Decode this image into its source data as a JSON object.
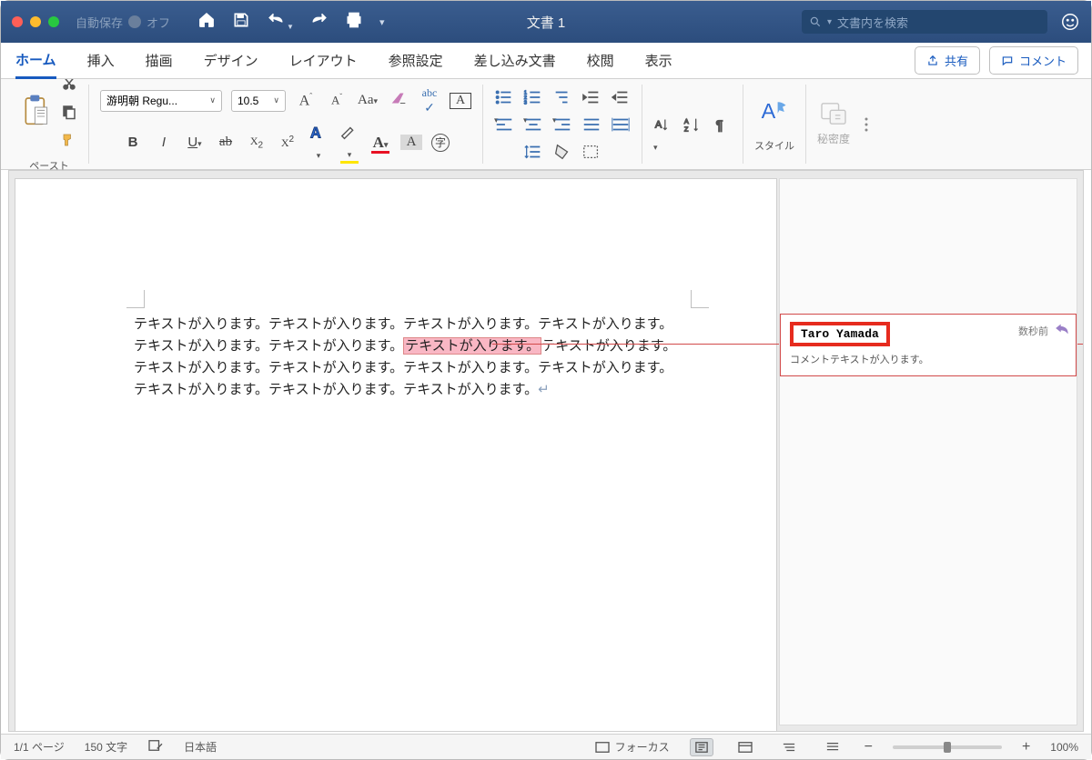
{
  "titlebar": {
    "autosave_label": "自動保存",
    "autosave_state": "オフ",
    "doc_title": "文書 1",
    "search_placeholder": "文書内を検索"
  },
  "tabs": {
    "items": [
      "ホーム",
      "挿入",
      "描画",
      "デザイン",
      "レイアウト",
      "参照設定",
      "差し込み文書",
      "校閲",
      "表示"
    ],
    "active": 0,
    "share": "共有",
    "comment": "コメント"
  },
  "ribbon": {
    "paste": "ペースト",
    "font_name": "游明朝 Regu...",
    "font_size": "10.5",
    "styles": "スタイル",
    "sensitivity": "秘密度"
  },
  "document": {
    "body_before": "テキストが入ります。テキストが入ります。テキストが入ります。テキストが入ります。テキストが入ります。テキストが入ります。",
    "body_highlight": "テキストが入ります。",
    "body_after": "テキストが入ります。テキストが入ります。テキストが入ります。テキストが入ります。テキストが入ります。テキストが入ります。テキストが入ります。テキストが入ります。"
  },
  "comment": {
    "author": "Taro Yamada",
    "time": "数秒前",
    "text": "コメントテキストが入ります。"
  },
  "status": {
    "page": "1/1 ページ",
    "words": "150 文字",
    "lang": "日本語",
    "focus": "フォーカス",
    "zoom": "100%"
  }
}
